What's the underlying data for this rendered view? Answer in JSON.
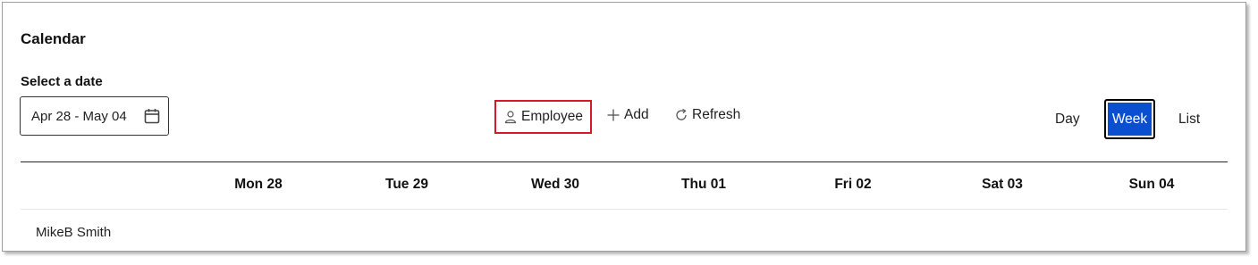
{
  "calendar": {
    "title": "Calendar",
    "date_label": "Select a date",
    "date_value": "Apr 28 - May 04"
  },
  "toolbar": {
    "employee_label": "Employee",
    "add_label": "Add",
    "refresh_label": "Refresh"
  },
  "views": {
    "day_label": "Day",
    "week_label": "Week",
    "list_label": "List",
    "selected": "Week",
    "selected_color": "#0b4fd1"
  },
  "week_days": [
    "Mon 28",
    "Tue 29",
    "Wed 30",
    "Thu 01",
    "Fri 02",
    "Sat 03",
    "Sun 04"
  ],
  "rows": [
    {
      "employee": "MikeB Smith"
    }
  ],
  "icons": {
    "date_picker": "calendar-icon",
    "employee": "person-icon",
    "add": "plus-icon",
    "refresh": "refresh-icon"
  },
  "highlight_color": "#d3192a"
}
